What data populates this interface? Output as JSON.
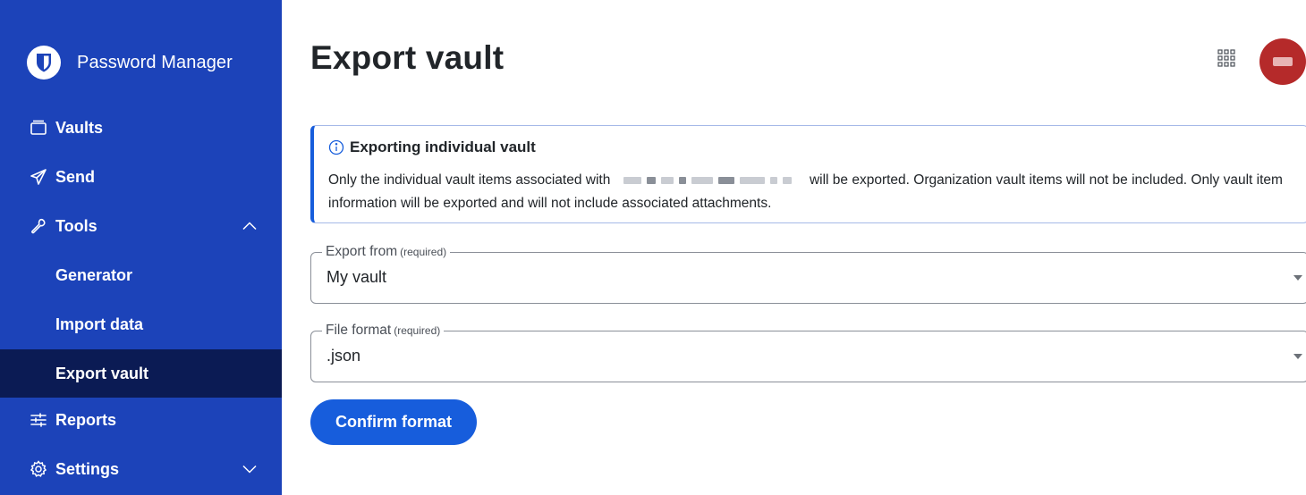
{
  "sidebar": {
    "brand": "Password Manager",
    "items": [
      {
        "label": "Vaults",
        "icon": "vault-icon"
      },
      {
        "label": "Send",
        "icon": "send-icon"
      },
      {
        "label": "Tools",
        "icon": "tools-icon",
        "expanded": true
      },
      {
        "label": "Generator"
      },
      {
        "label": "Import data"
      },
      {
        "label": "Export vault",
        "active": true
      },
      {
        "label": "Reports",
        "icon": "reports-icon"
      },
      {
        "label": "Settings",
        "icon": "settings-icon",
        "expanded": false
      }
    ]
  },
  "header": {
    "title": "Export vault"
  },
  "callout": {
    "title": "Exporting individual vault",
    "body_before": "Only the individual vault items associated with",
    "body_after": "will be exported. Organization vault items will not be included. Only vault item information will be exported and will not include associated attachments."
  },
  "form": {
    "export_from": {
      "label": "Export from",
      "required": "(required)",
      "value": "My vault"
    },
    "file_format": {
      "label": "File format",
      "required": "(required)",
      "value": ".json"
    },
    "confirm_label": "Confirm format"
  },
  "colors": {
    "sidebar": "#1c43b9",
    "sidebar_active": "#0b1b54",
    "primary": "#175ddc",
    "avatar": "#b52a2a"
  }
}
